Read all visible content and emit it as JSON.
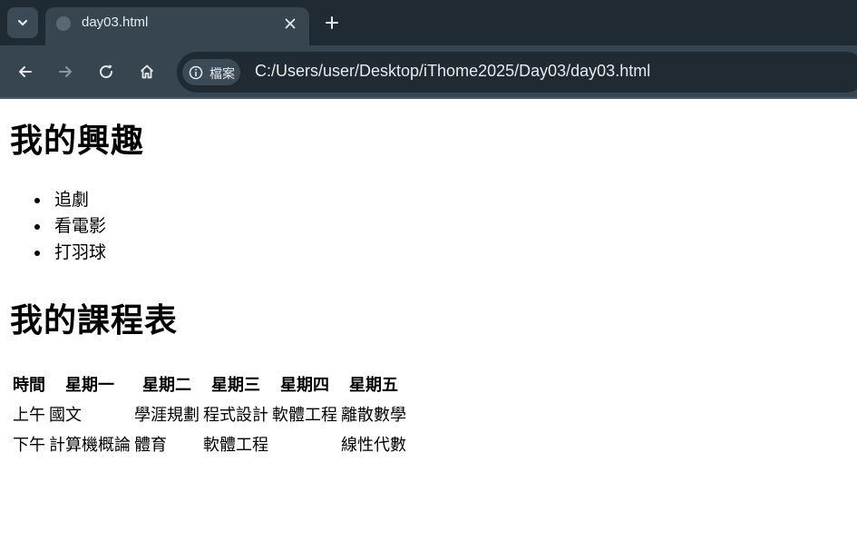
{
  "browser": {
    "tab": {
      "title": "day03.html",
      "favicon": "globe-icon"
    },
    "toolbar": {
      "site_info_label": "檔案",
      "url": "C:/Users/user/Desktop/iThome2025/Day03/day03.html"
    },
    "colors": {
      "tabbar": "#202a33",
      "toolbar": "#36454f",
      "text": "#e8eaed"
    }
  },
  "page": {
    "interests_heading": "我的興趣",
    "interests": [
      "追劇",
      "看電影",
      "打羽球"
    ],
    "schedule_heading": "我的課程表",
    "schedule": {
      "headers": [
        "時間",
        "星期一",
        "星期二",
        "星期三",
        "星期四",
        "星期五"
      ],
      "rows": [
        [
          "上午",
          "國文",
          "學涯規劃",
          "程式設計",
          "軟體工程",
          "離散數學"
        ],
        [
          "下午",
          "計算機概論",
          "體育",
          "軟體工程",
          "",
          "線性代數"
        ]
      ]
    }
  }
}
